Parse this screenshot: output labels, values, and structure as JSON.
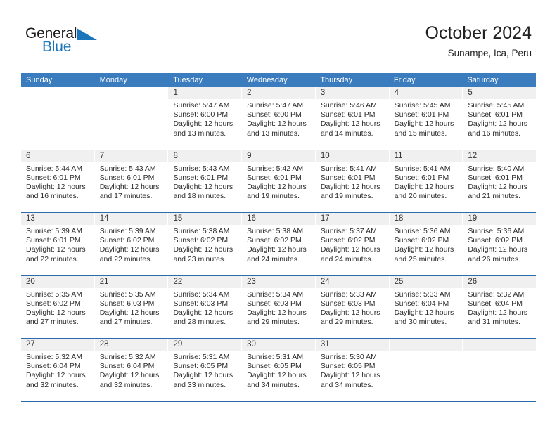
{
  "brand": {
    "name_part1": "General",
    "name_part2": "Blue",
    "accent_color": "#1b75bb"
  },
  "header": {
    "title": "October 2024",
    "subtitle": "Sunampe, Ica, Peru"
  },
  "theme": {
    "header_row_color": "#3a7cbe",
    "week_divider_color": "#2b6cad",
    "daynum_band_color": "#f0f0f0"
  },
  "calendar": {
    "day_headers": [
      "Sunday",
      "Monday",
      "Tuesday",
      "Wednesday",
      "Thursday",
      "Friday",
      "Saturday"
    ],
    "weeks": [
      [
        {
          "day": "",
          "blank": true
        },
        {
          "day": "",
          "blank": true
        },
        {
          "day": "1",
          "sunrise": "Sunrise: 5:47 AM",
          "sunset": "Sunset: 6:00 PM",
          "daylight1": "Daylight: 12 hours",
          "daylight2": "and 13 minutes."
        },
        {
          "day": "2",
          "sunrise": "Sunrise: 5:47 AM",
          "sunset": "Sunset: 6:00 PM",
          "daylight1": "Daylight: 12 hours",
          "daylight2": "and 13 minutes."
        },
        {
          "day": "3",
          "sunrise": "Sunrise: 5:46 AM",
          "sunset": "Sunset: 6:01 PM",
          "daylight1": "Daylight: 12 hours",
          "daylight2": "and 14 minutes."
        },
        {
          "day": "4",
          "sunrise": "Sunrise: 5:45 AM",
          "sunset": "Sunset: 6:01 PM",
          "daylight1": "Daylight: 12 hours",
          "daylight2": "and 15 minutes."
        },
        {
          "day": "5",
          "sunrise": "Sunrise: 5:45 AM",
          "sunset": "Sunset: 6:01 PM",
          "daylight1": "Daylight: 12 hours",
          "daylight2": "and 16 minutes."
        }
      ],
      [
        {
          "day": "6",
          "sunrise": "Sunrise: 5:44 AM",
          "sunset": "Sunset: 6:01 PM",
          "daylight1": "Daylight: 12 hours",
          "daylight2": "and 16 minutes."
        },
        {
          "day": "7",
          "sunrise": "Sunrise: 5:43 AM",
          "sunset": "Sunset: 6:01 PM",
          "daylight1": "Daylight: 12 hours",
          "daylight2": "and 17 minutes."
        },
        {
          "day": "8",
          "sunrise": "Sunrise: 5:43 AM",
          "sunset": "Sunset: 6:01 PM",
          "daylight1": "Daylight: 12 hours",
          "daylight2": "and 18 minutes."
        },
        {
          "day": "9",
          "sunrise": "Sunrise: 5:42 AM",
          "sunset": "Sunset: 6:01 PM",
          "daylight1": "Daylight: 12 hours",
          "daylight2": "and 19 minutes."
        },
        {
          "day": "10",
          "sunrise": "Sunrise: 5:41 AM",
          "sunset": "Sunset: 6:01 PM",
          "daylight1": "Daylight: 12 hours",
          "daylight2": "and 19 minutes."
        },
        {
          "day": "11",
          "sunrise": "Sunrise: 5:41 AM",
          "sunset": "Sunset: 6:01 PM",
          "daylight1": "Daylight: 12 hours",
          "daylight2": "and 20 minutes."
        },
        {
          "day": "12",
          "sunrise": "Sunrise: 5:40 AM",
          "sunset": "Sunset: 6:01 PM",
          "daylight1": "Daylight: 12 hours",
          "daylight2": "and 21 minutes."
        }
      ],
      [
        {
          "day": "13",
          "sunrise": "Sunrise: 5:39 AM",
          "sunset": "Sunset: 6:01 PM",
          "daylight1": "Daylight: 12 hours",
          "daylight2": "and 22 minutes."
        },
        {
          "day": "14",
          "sunrise": "Sunrise: 5:39 AM",
          "sunset": "Sunset: 6:02 PM",
          "daylight1": "Daylight: 12 hours",
          "daylight2": "and 22 minutes."
        },
        {
          "day": "15",
          "sunrise": "Sunrise: 5:38 AM",
          "sunset": "Sunset: 6:02 PM",
          "daylight1": "Daylight: 12 hours",
          "daylight2": "and 23 minutes."
        },
        {
          "day": "16",
          "sunrise": "Sunrise: 5:38 AM",
          "sunset": "Sunset: 6:02 PM",
          "daylight1": "Daylight: 12 hours",
          "daylight2": "and 24 minutes."
        },
        {
          "day": "17",
          "sunrise": "Sunrise: 5:37 AM",
          "sunset": "Sunset: 6:02 PM",
          "daylight1": "Daylight: 12 hours",
          "daylight2": "and 24 minutes."
        },
        {
          "day": "18",
          "sunrise": "Sunrise: 5:36 AM",
          "sunset": "Sunset: 6:02 PM",
          "daylight1": "Daylight: 12 hours",
          "daylight2": "and 25 minutes."
        },
        {
          "day": "19",
          "sunrise": "Sunrise: 5:36 AM",
          "sunset": "Sunset: 6:02 PM",
          "daylight1": "Daylight: 12 hours",
          "daylight2": "and 26 minutes."
        }
      ],
      [
        {
          "day": "20",
          "sunrise": "Sunrise: 5:35 AM",
          "sunset": "Sunset: 6:02 PM",
          "daylight1": "Daylight: 12 hours",
          "daylight2": "and 27 minutes."
        },
        {
          "day": "21",
          "sunrise": "Sunrise: 5:35 AM",
          "sunset": "Sunset: 6:03 PM",
          "daylight1": "Daylight: 12 hours",
          "daylight2": "and 27 minutes."
        },
        {
          "day": "22",
          "sunrise": "Sunrise: 5:34 AM",
          "sunset": "Sunset: 6:03 PM",
          "daylight1": "Daylight: 12 hours",
          "daylight2": "and 28 minutes."
        },
        {
          "day": "23",
          "sunrise": "Sunrise: 5:34 AM",
          "sunset": "Sunset: 6:03 PM",
          "daylight1": "Daylight: 12 hours",
          "daylight2": "and 29 minutes."
        },
        {
          "day": "24",
          "sunrise": "Sunrise: 5:33 AM",
          "sunset": "Sunset: 6:03 PM",
          "daylight1": "Daylight: 12 hours",
          "daylight2": "and 29 minutes."
        },
        {
          "day": "25",
          "sunrise": "Sunrise: 5:33 AM",
          "sunset": "Sunset: 6:04 PM",
          "daylight1": "Daylight: 12 hours",
          "daylight2": "and 30 minutes."
        },
        {
          "day": "26",
          "sunrise": "Sunrise: 5:32 AM",
          "sunset": "Sunset: 6:04 PM",
          "daylight1": "Daylight: 12 hours",
          "daylight2": "and 31 minutes."
        }
      ],
      [
        {
          "day": "27",
          "sunrise": "Sunrise: 5:32 AM",
          "sunset": "Sunset: 6:04 PM",
          "daylight1": "Daylight: 12 hours",
          "daylight2": "and 32 minutes."
        },
        {
          "day": "28",
          "sunrise": "Sunrise: 5:32 AM",
          "sunset": "Sunset: 6:04 PM",
          "daylight1": "Daylight: 12 hours",
          "daylight2": "and 32 minutes."
        },
        {
          "day": "29",
          "sunrise": "Sunrise: 5:31 AM",
          "sunset": "Sunset: 6:05 PM",
          "daylight1": "Daylight: 12 hours",
          "daylight2": "and 33 minutes."
        },
        {
          "day": "30",
          "sunrise": "Sunrise: 5:31 AM",
          "sunset": "Sunset: 6:05 PM",
          "daylight1": "Daylight: 12 hours",
          "daylight2": "and 34 minutes."
        },
        {
          "day": "31",
          "sunrise": "Sunrise: 5:30 AM",
          "sunset": "Sunset: 6:05 PM",
          "daylight1": "Daylight: 12 hours",
          "daylight2": "and 34 minutes."
        },
        {
          "day": "",
          "empty": true
        },
        {
          "day": "",
          "empty": true
        }
      ]
    ]
  }
}
